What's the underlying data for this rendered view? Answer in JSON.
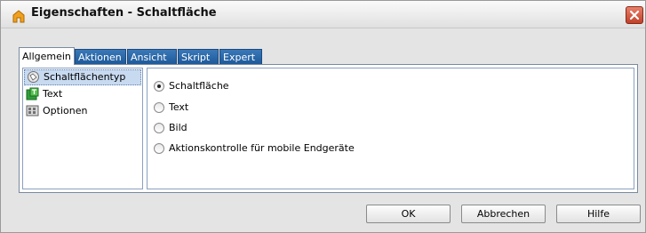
{
  "window": {
    "title": "Eigenschaften - Schaltfläche",
    "title_icon": "app-icon",
    "close_icon": "close-icon"
  },
  "tabs": [
    {
      "label": "Allgemein",
      "active": true
    },
    {
      "label": "Aktionen",
      "active": false
    },
    {
      "label": "Ansicht",
      "active": false
    },
    {
      "label": "Skript",
      "active": false
    },
    {
      "label": "Expert",
      "active": false
    }
  ],
  "categories": [
    {
      "label": "Schaltflächentyp",
      "icon": "button-type-icon",
      "selected": true
    },
    {
      "label": "Text",
      "icon": "text-icon",
      "selected": false
    },
    {
      "label": "Optionen",
      "icon": "options-icon",
      "selected": false
    }
  ],
  "button_type_options": [
    {
      "label": "Schaltfläche",
      "checked": true
    },
    {
      "label": "Text",
      "checked": false
    },
    {
      "label": "Bild",
      "checked": false
    },
    {
      "label": "Aktionskontrolle für mobile Endgeräte",
      "checked": false
    }
  ],
  "buttons": {
    "ok": "OK",
    "cancel": "Abbrechen",
    "help": "Hilfe"
  },
  "colors": {
    "tab_inactive": "#1e5a9a",
    "close_button": "#c0402a",
    "selection": "#c8daf0"
  }
}
